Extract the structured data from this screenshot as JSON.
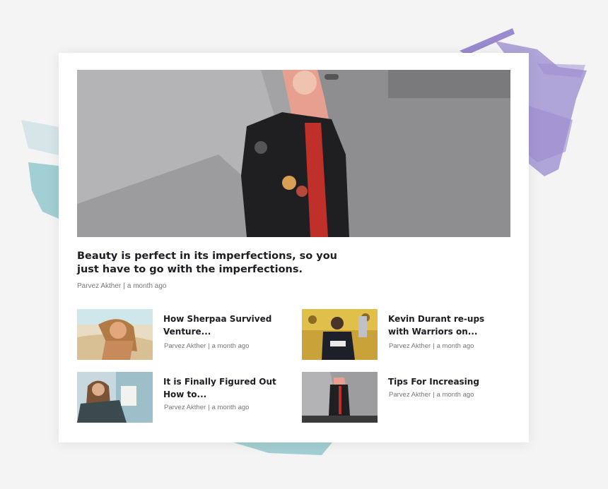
{
  "featured": {
    "title": "Beauty is perfect in its imperfections, so you just have to go with the imperfections.",
    "author": "Parvez Akther",
    "separator": "|",
    "time": "a month ago"
  },
  "posts": [
    {
      "title": "How Sherpaa Survived Venture...",
      "author": "Parvez Akther",
      "separator": "|",
      "time": "a month ago",
      "image": "surfer-woman-photo"
    },
    {
      "title": "Kevin Durant re-ups with Warriors on...",
      "author": "Parvez Akther",
      "separator": "|",
      "time": "a month ago",
      "image": "basketball-player-photo"
    },
    {
      "title": "It is Finally Figured Out  How to...",
      "author": "Parvez Akther",
      "separator": "|",
      "time": "a month ago",
      "image": "woman-reading-photo"
    },
    {
      "title": "Tips For Increasing",
      "author": "Parvez Akther",
      "separator": "|",
      "time": "a month ago",
      "image": "leather-jacket-photo"
    }
  ],
  "colors": {
    "accent_purple": "#8a78c8",
    "accent_teal": "#7fbfc4",
    "title": "#1d1d24",
    "meta": "#777777",
    "background": "#f4f4f5"
  }
}
